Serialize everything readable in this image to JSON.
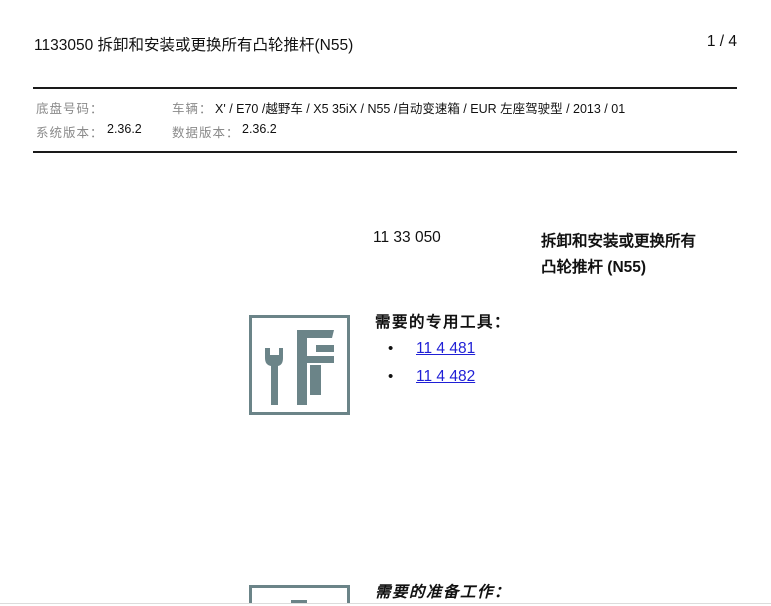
{
  "header": {
    "title": "1133050 拆卸和安装或更换所有凸轮推杆(N55)",
    "page_indicator": "1 / 4"
  },
  "info": {
    "chassis_label": "底盘号码：",
    "vehicle_label": "车辆：",
    "vehicle_value": "X' / E70 /越野车 / X5 35iX / N55 /自动变速箱 / EUR 左座驾驶型 / 2013 / 01",
    "system_version_label": "系统版本：",
    "system_version_value": "2.36.2",
    "data_version_label": "数据版本：",
    "data_version_value": "2.36.2"
  },
  "procedure": {
    "code": "11 33 050",
    "title_lines": [
      "拆卸和安装或更换所有",
      "凸轮推杆 (N55)"
    ]
  },
  "special_tools": {
    "heading": "需要的专用工具：",
    "icon": "special-tools-icon",
    "items": [
      "11 4 481",
      "11 4 482"
    ]
  },
  "preparation": {
    "heading": "需要的准备工作：",
    "icon": "preparation-work-icon"
  },
  "colors": {
    "text": "#111111",
    "label": "#8a8a8a",
    "rule": "#1a1a1a",
    "icon": "#6b8488",
    "link": "#1f1fd6"
  }
}
